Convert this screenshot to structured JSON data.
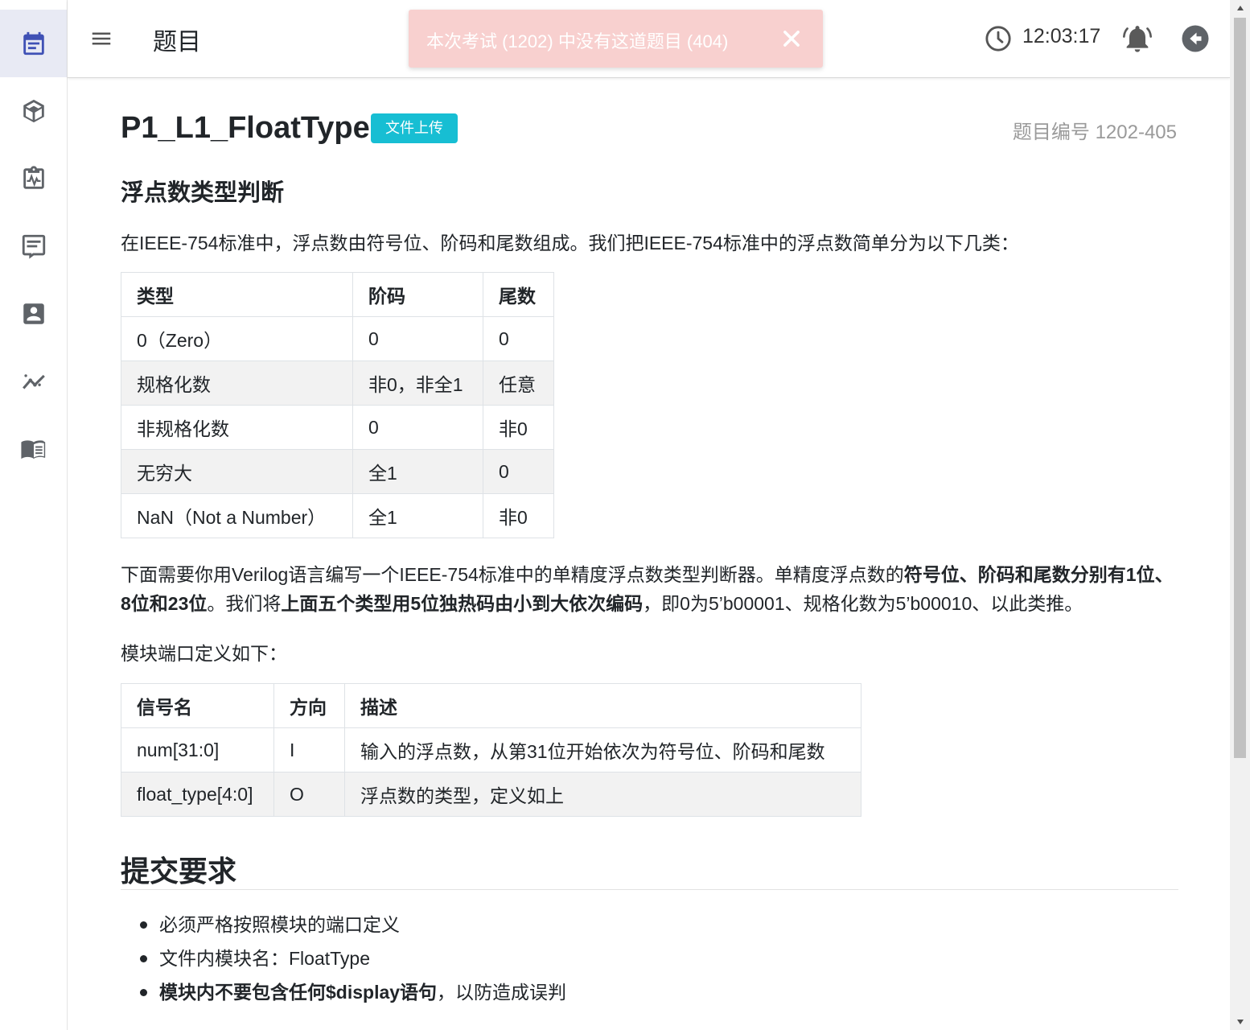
{
  "header": {
    "title": "题目",
    "time": "12:03:17"
  },
  "toast": {
    "message": "本次考试 (1202) 中没有这道题目 (404)"
  },
  "sidebar": {
    "items": [
      {
        "icon": "calendar-list-icon",
        "active": true
      },
      {
        "icon": "cube-icon",
        "active": false
      },
      {
        "icon": "clipboard-pulse-icon",
        "active": false
      },
      {
        "icon": "message-icon",
        "active": false
      },
      {
        "icon": "account-box-icon",
        "active": false
      },
      {
        "icon": "chart-line-icon",
        "active": false
      },
      {
        "icon": "book-icon",
        "active": false
      }
    ]
  },
  "problem": {
    "title": "P1_L1_FloatType",
    "badge": "文件上传",
    "id_text": "题目编号 1202-405",
    "section_title": "浮点数类型判断",
    "intro": "在IEEE-754标准中，浮点数由符号位、阶码和尾数组成。我们把IEEE-754标准中的浮点数简单分为以下几类：",
    "type_table": {
      "headers": [
        "类型",
        "阶码",
        "尾数"
      ],
      "rows": [
        [
          "0（Zero）",
          "0",
          "0"
        ],
        [
          "规格化数",
          "非0，非全1",
          "任意"
        ],
        [
          "非规格化数",
          "0",
          "非0"
        ],
        [
          "无穷大",
          "全1",
          "0"
        ],
        [
          "NaN（Not a Number）",
          "全1",
          "非0"
        ]
      ]
    },
    "desc": {
      "part1": "下面需要你用Verilog语言编写一个IEEE-754标准中的单精度浮点数类型判断器。单精度浮点数的",
      "bold1": "符号位、阶码和尾数分别有1位、8位和23位",
      "part2": "。我们将",
      "bold2": "上面五个类型用5位独热码由小到大依次编码",
      "part3": "，即0为5’b00001、规格化数为5’b00010、以此类推。"
    },
    "port_intro": "模块端口定义如下：",
    "port_table": {
      "headers": [
        "信号名",
        "方向",
        "描述"
      ],
      "rows": [
        [
          "num[31:0]",
          "I",
          "输入的浮点数，从第31位开始依次为符号位、阶码和尾数"
        ],
        [
          "float_type[4:0]",
          "O",
          "浮点数的类型，定义如上"
        ]
      ]
    },
    "submit_title": "提交要求",
    "requirements": {
      "r1": "必须严格按照模块的端口定义",
      "r2": "文件内模块名：FloatType",
      "r3_bold": "模块内不要包含任何$display语句",
      "r3_rest": "，以防造成误判"
    }
  }
}
